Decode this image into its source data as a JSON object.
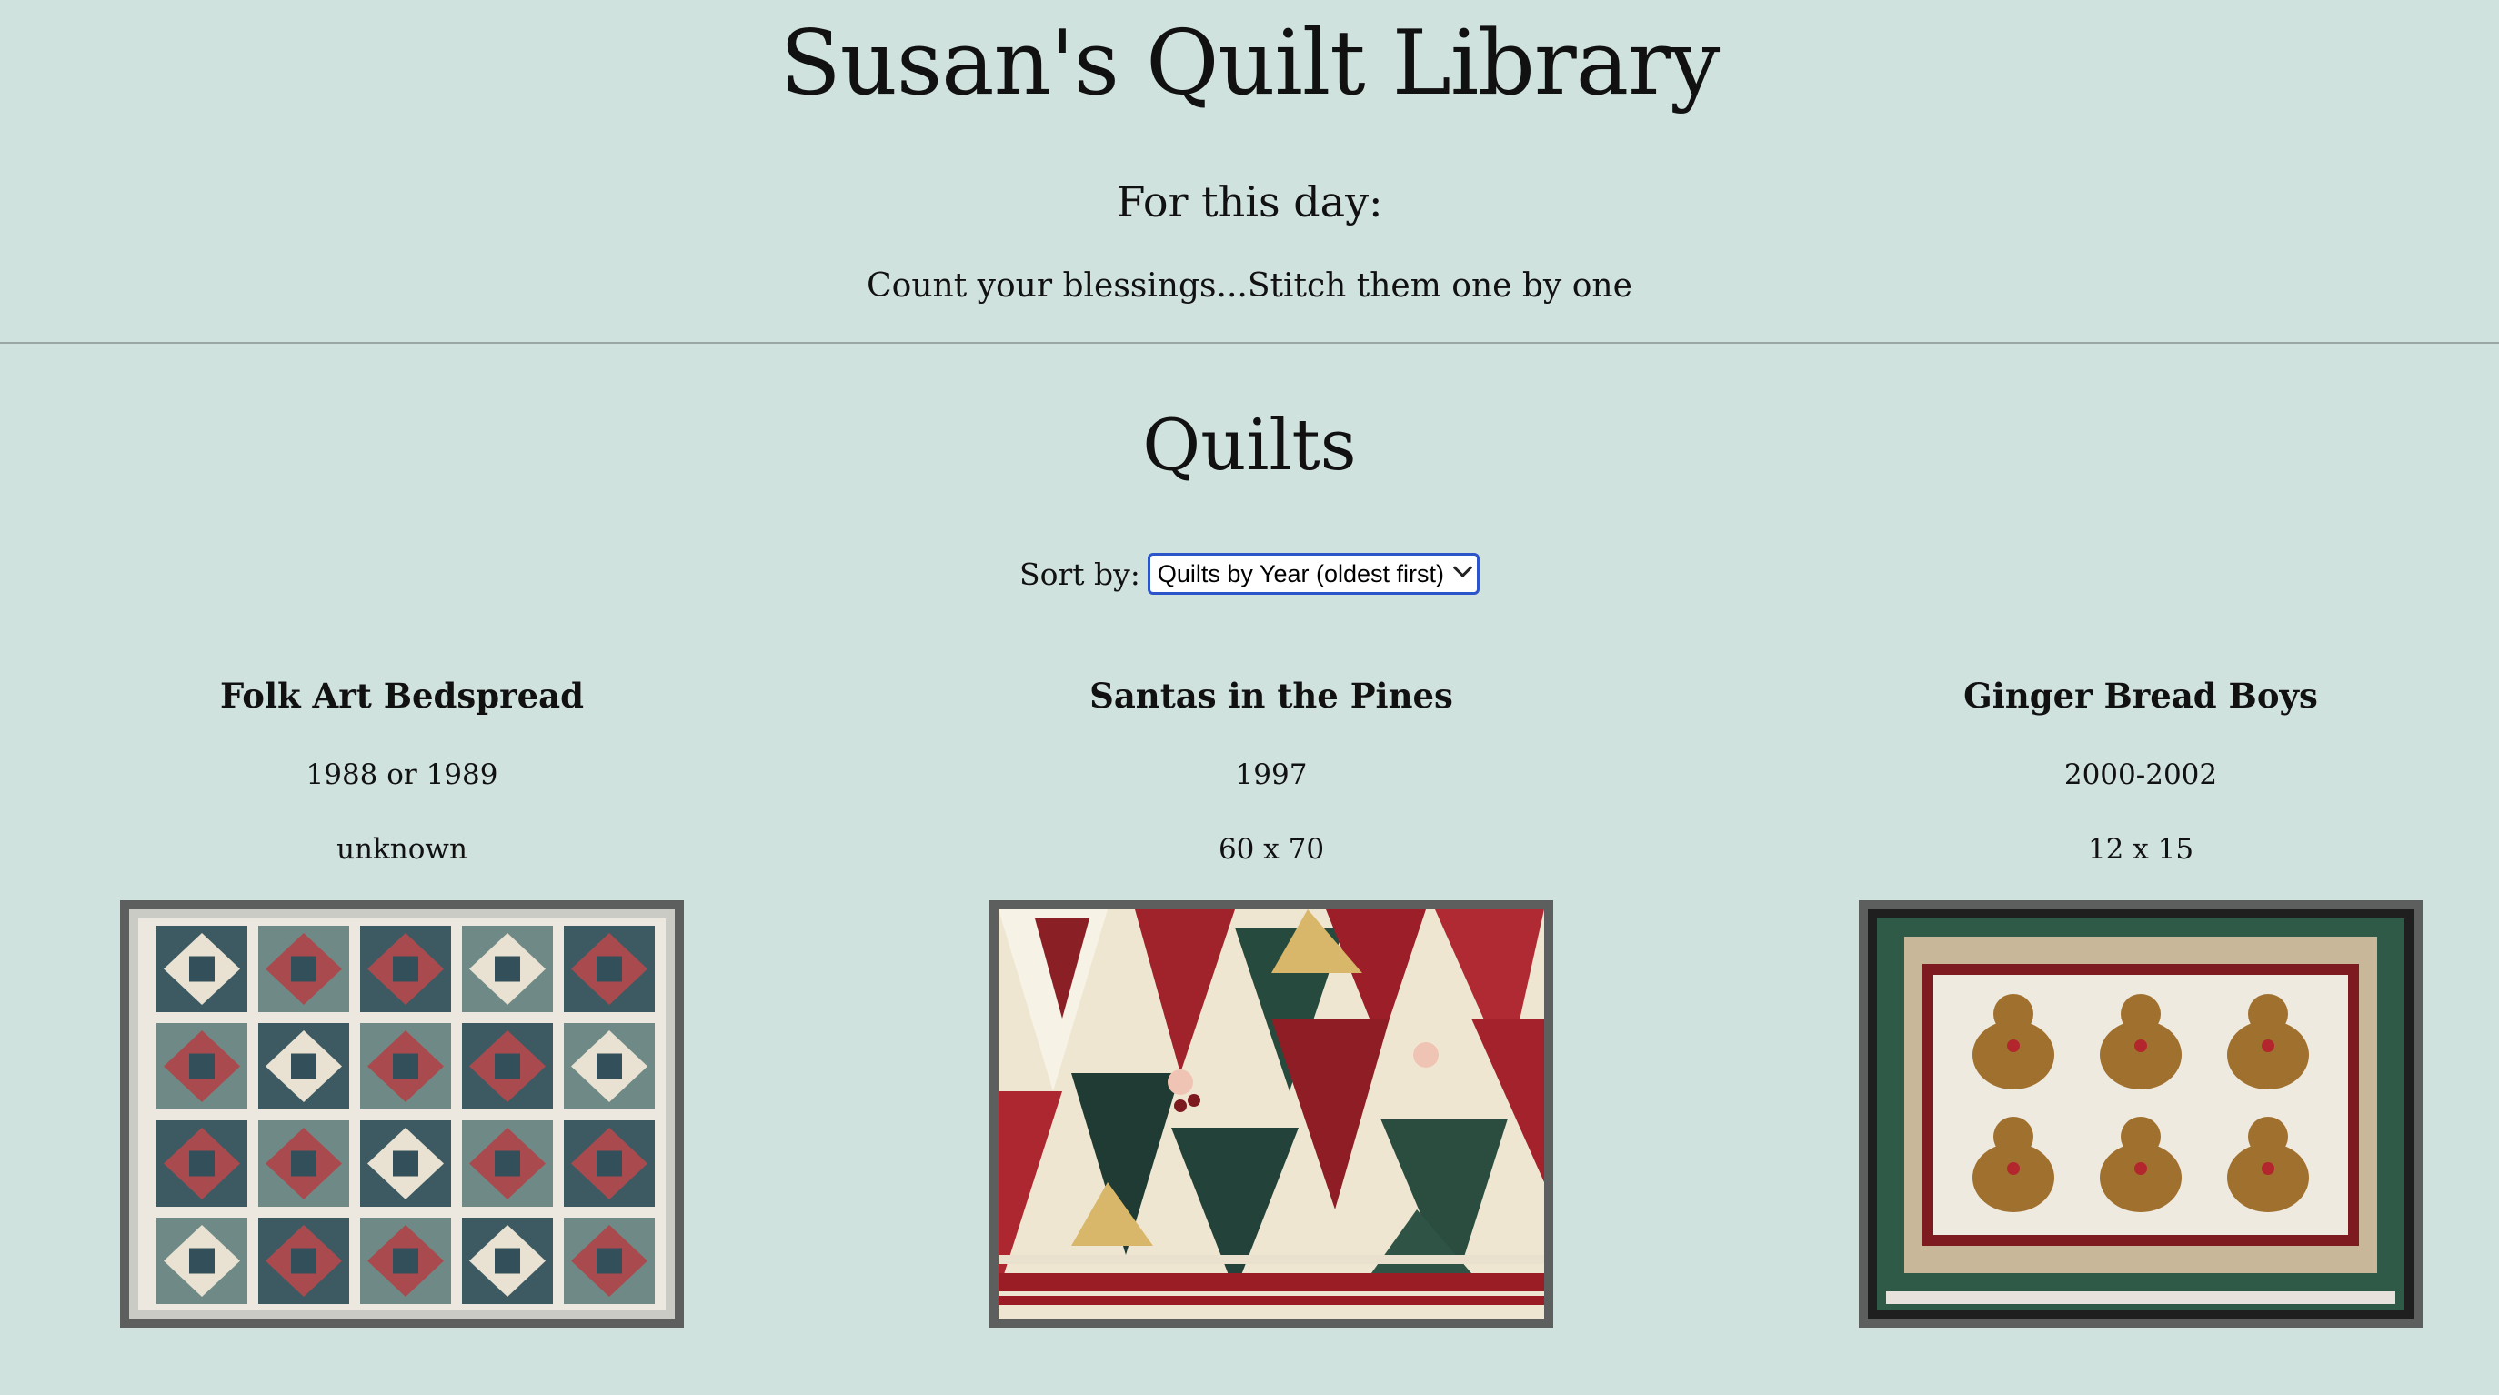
{
  "site": {
    "title": "Susan's Quilt Library"
  },
  "day": {
    "heading": "For this day:",
    "quote": "Count your blessings...Stitch them one by one"
  },
  "quilts_section": {
    "title": "Quilts",
    "sort": {
      "label": "Sort by:",
      "selected": "Quilts by Year (oldest first)"
    }
  },
  "quilts": [
    {
      "name": "Folk Art Bedspread",
      "year": "1988 or 1989",
      "size": "unknown",
      "photo_alt": "blue and red folk art quilt"
    },
    {
      "name": "Santas in the Pines",
      "year": "1997",
      "size": "60 x 70",
      "photo_alt": "red and green tree quilt"
    },
    {
      "name": "Ginger Bread Boys",
      "year": "2000-2002",
      "size": "12 x 15",
      "photo_alt": "gingerbread boys quilt"
    }
  ],
  "colors": {
    "background": "#d0e2de",
    "select_border": "#2b55c9",
    "photo_frame": "#5d5f5f"
  }
}
